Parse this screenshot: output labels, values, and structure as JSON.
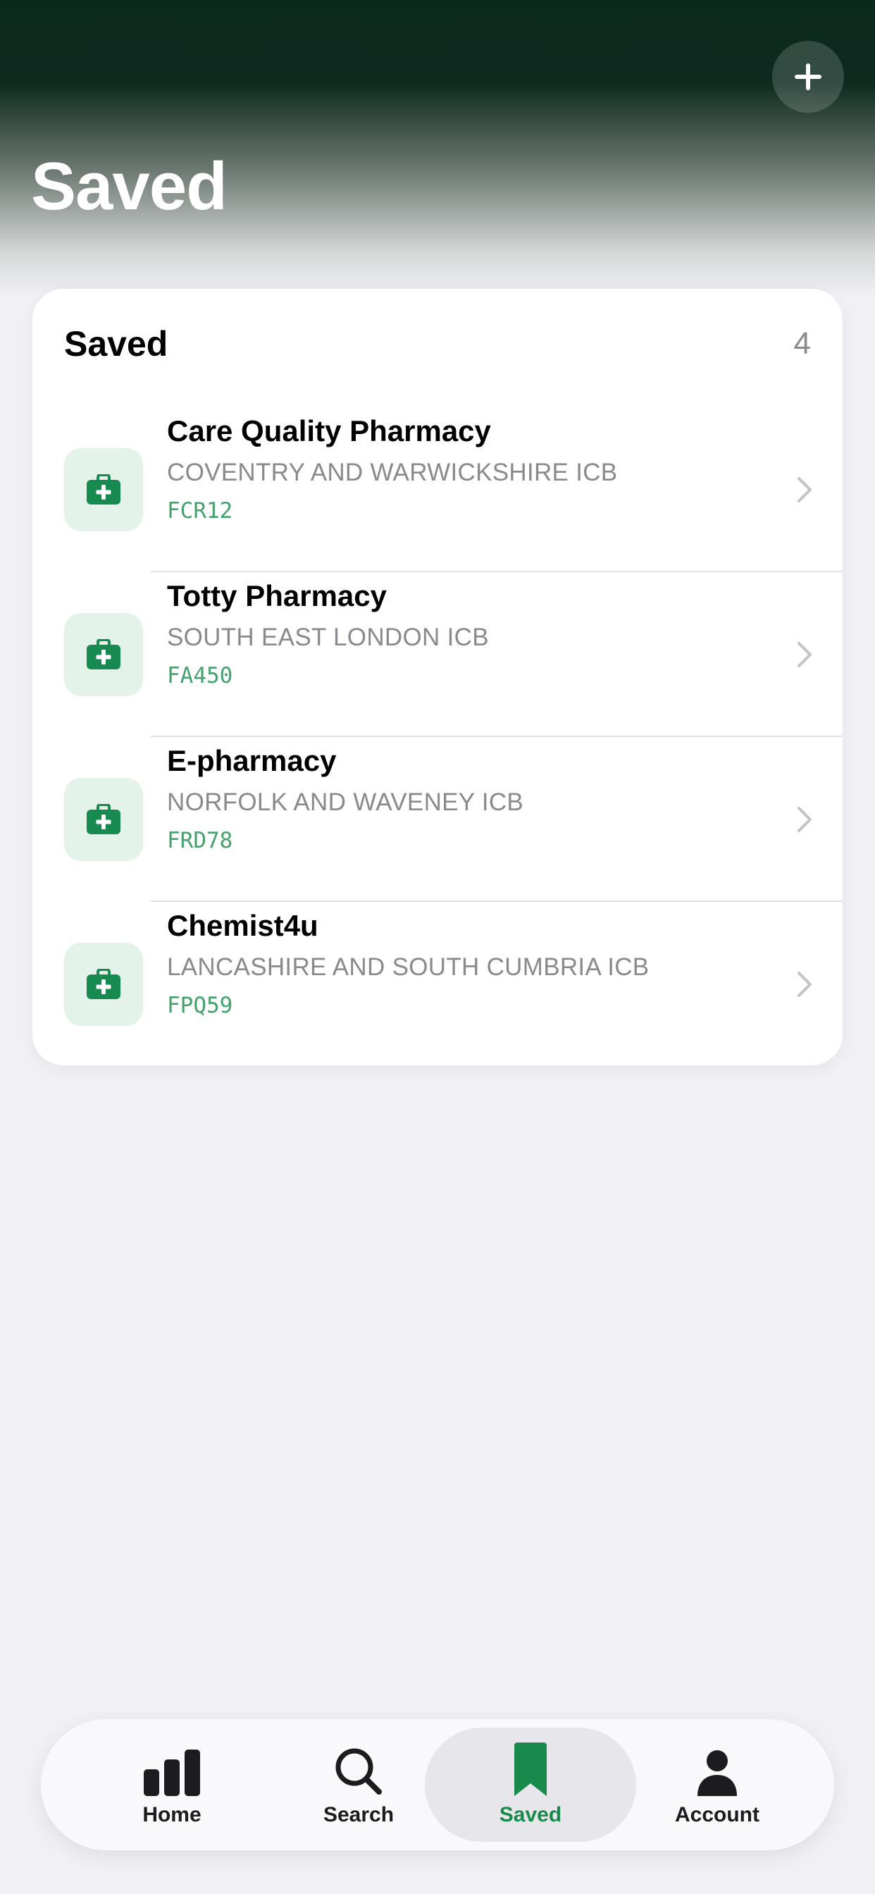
{
  "header": {
    "title": "Saved",
    "add_icon": "plus-icon"
  },
  "card": {
    "title": "Saved",
    "count": "4",
    "items": [
      {
        "name": "Care Quality Pharmacy",
        "region": "COVENTRY AND WARWICKSHIRE ICB",
        "code": "FCR12",
        "icon": "medical-kit-icon"
      },
      {
        "name": "Totty Pharmacy",
        "region": "SOUTH EAST LONDON ICB",
        "code": "FA450",
        "icon": "medical-kit-icon"
      },
      {
        "name": "E-pharmacy",
        "region": "NORFOLK AND WAVENEY ICB",
        "code": "FRD78",
        "icon": "medical-kit-icon"
      },
      {
        "name": "Chemist4u",
        "region": "LANCASHIRE AND SOUTH CUMBRIA ICB",
        "code": "FPQ59",
        "icon": "medical-kit-icon"
      }
    ]
  },
  "tabbar": {
    "tabs": [
      {
        "label": "Home",
        "icon": "bar-chart-icon",
        "active": false
      },
      {
        "label": "Search",
        "icon": "magnifier-icon",
        "active": false
      },
      {
        "label": "Saved",
        "icon": "bookmark-icon",
        "active": true
      },
      {
        "label": "Account",
        "icon": "person-icon",
        "active": false
      }
    ]
  },
  "colors": {
    "accent": "#1a8a4c",
    "header_dark": "#0b2a1e",
    "icon_bg": "#e4f3ea",
    "code_green": "#45a26d",
    "secondary_text": "#8a8a8e",
    "background": "#f0f0f5"
  }
}
